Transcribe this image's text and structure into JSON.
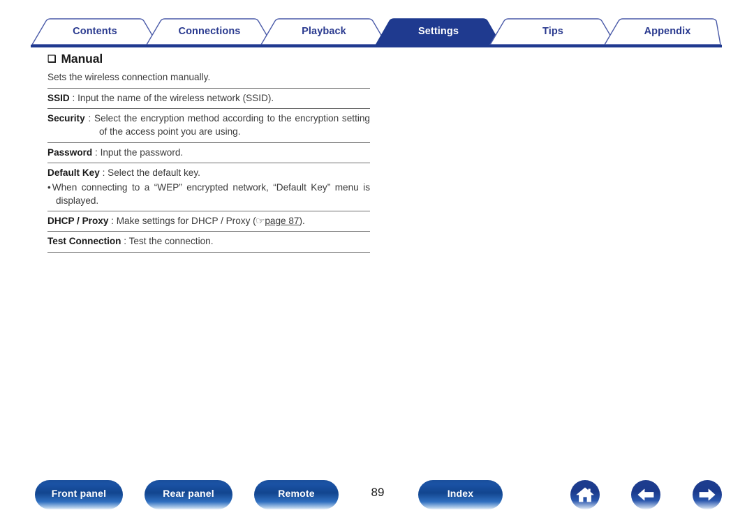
{
  "document": {
    "page_number": "89",
    "active_tab": "Settings"
  },
  "tabs": [
    {
      "label": "Contents",
      "active": false
    },
    {
      "label": "Connections",
      "active": false
    },
    {
      "label": "Playback",
      "active": false
    },
    {
      "label": "Settings",
      "active": true
    },
    {
      "label": "Tips",
      "active": false
    },
    {
      "label": "Appendix",
      "active": false
    }
  ],
  "section": {
    "bullet_glyph": "❑",
    "heading": "Manual",
    "lead": "Sets the wireless connection manually."
  },
  "entries": [
    {
      "term": "SSID",
      "separator": " : ",
      "description": "Input the name of the wireless network (SSID)."
    },
    {
      "term": "Security",
      "separator": " : ",
      "description": "Select the encryption method according to the encryption setting of the access point you are using."
    },
    {
      "term": "Password",
      "separator": " : ",
      "description": "Input the password."
    },
    {
      "term": "Default Key",
      "separator": " : ",
      "description": "Select the default key."
    }
  ],
  "note": {
    "bullet": "•",
    "text": "When connecting to a “WEP” encrypted network, “Default Key” menu is displayed."
  },
  "dhcp_entry": {
    "term": "DHCP / Proxy",
    "separator": " : ",
    "description_before": "Make settings for DHCP / Proxy (",
    "hand_glyph": "☞",
    "link_text": "page 87",
    "description_after": ")."
  },
  "test_entry": {
    "term": "Test Connection",
    "separator": " : ",
    "description": "Test the connection."
  },
  "footer": {
    "buttons": [
      {
        "label": "Front panel"
      },
      {
        "label": "Rear panel"
      },
      {
        "label": "Remote"
      },
      {
        "label": "Index"
      }
    ],
    "icon_buttons": [
      {
        "name": "home-icon"
      },
      {
        "name": "arrow-left-icon"
      },
      {
        "name": "arrow-right-icon"
      }
    ]
  },
  "colors": {
    "tab_active_bg": "#1f3a8f",
    "tab_text": "#2a3a8f",
    "rule": "#6d6d6d",
    "body_text": "#3a3a3a"
  }
}
